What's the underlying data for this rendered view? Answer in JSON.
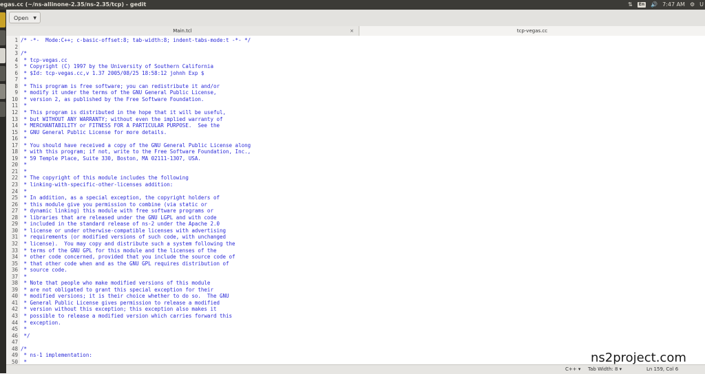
{
  "window": {
    "title": "egas.cc (~/ns-allinone-2.35/ns-2.35/tcp) - gedit"
  },
  "tray": {
    "keyboard": "En",
    "time": "7:47 AM",
    "user": "U"
  },
  "toolbar": {
    "open_label": "Open"
  },
  "tabs": [
    {
      "label": "Main.tcl",
      "close": "×"
    },
    {
      "label": "tcp-vegas.cc"
    }
  ],
  "editor": {
    "lines": [
      {
        "n": "1",
        "text": "/* -*-  Mode:C++; c-basic-offset:8; tab-width:8; indent-tabs-mode:t -*- */"
      },
      {
        "n": "2",
        "text": ""
      },
      {
        "n": "3",
        "text": "/*"
      },
      {
        "n": "4",
        "text": " * tcp-vegas.cc"
      },
      {
        "n": "5",
        "text": " * Copyright (C) 1997 by the University of Southern California"
      },
      {
        "n": "6",
        "text": " * $Id: tcp-vegas.cc,v 1.37 2005/08/25 18:58:12 johnh Exp $"
      },
      {
        "n": "7",
        "text": " *"
      },
      {
        "n": "8",
        "text": " * This program is free software; you can redistribute it and/or"
      },
      {
        "n": "9",
        "text": " * modify it under the terms of the GNU General Public License,"
      },
      {
        "n": "10",
        "text": " * version 2, as published by the Free Software Foundation."
      },
      {
        "n": "11",
        "text": " *"
      },
      {
        "n": "12",
        "text": " * This program is distributed in the hope that it will be useful,"
      },
      {
        "n": "13",
        "text": " * but WITHOUT ANY WARRANTY; without even the implied warranty of"
      },
      {
        "n": "14",
        "text": " * MERCHANTABILITY or FITNESS FOR A PARTICULAR PURPOSE.  See the"
      },
      {
        "n": "15",
        "text": " * GNU General Public License for more details."
      },
      {
        "n": "16",
        "text": " *"
      },
      {
        "n": "17",
        "text": " * You should have received a copy of the GNU General Public License along"
      },
      {
        "n": "18",
        "text": " * with this program; if not, write to the Free Software Foundation, Inc.,"
      },
      {
        "n": "19",
        "text": " * 59 Temple Place, Suite 330, Boston, MA 02111-1307, USA."
      },
      {
        "n": "20",
        "text": " *"
      },
      {
        "n": "21",
        "text": " *"
      },
      {
        "n": "22",
        "text": " * The copyright of this module includes the following"
      },
      {
        "n": "23",
        "text": " * linking-with-specific-other-licenses addition:"
      },
      {
        "n": "24",
        "text": " *"
      },
      {
        "n": "25",
        "text": " * In addition, as a special exception, the copyright holders of"
      },
      {
        "n": "26",
        "text": " * this module give you permission to combine (via static or"
      },
      {
        "n": "27",
        "text": " * dynamic linking) this module with free software programs or"
      },
      {
        "n": "28",
        "text": " * libraries that are released under the GNU LGPL and with code"
      },
      {
        "n": "29",
        "text": " * included in the standard release of ns-2 under the Apache 2.0"
      },
      {
        "n": "30",
        "text": " * license or under otherwise-compatible licenses with advertising"
      },
      {
        "n": "31",
        "text": " * requirements (or modified versions of such code, with unchanged"
      },
      {
        "n": "32",
        "text": " * license).  You may copy and distribute such a system following the"
      },
      {
        "n": "33",
        "text": " * terms of the GNU GPL for this module and the licenses of the"
      },
      {
        "n": "34",
        "text": " * other code concerned, provided that you include the source code of"
      },
      {
        "n": "35",
        "text": " * that other code when and as the GNU GPL requires distribution of"
      },
      {
        "n": "36",
        "text": " * source code."
      },
      {
        "n": "37",
        "text": " *"
      },
      {
        "n": "38",
        "text": " * Note that people who make modified versions of this module"
      },
      {
        "n": "39",
        "text": " * are not obligated to grant this special exception for their"
      },
      {
        "n": "40",
        "text": " * modified versions; it is their choice whether to do so.  The GNU"
      },
      {
        "n": "41",
        "text": " * General Public License gives permission to release a modified"
      },
      {
        "n": "42",
        "text": " * version without this exception; this exception also makes it"
      },
      {
        "n": "43",
        "text": " * possible to release a modified version which carries forward this"
      },
      {
        "n": "44",
        "text": " * exception."
      },
      {
        "n": "45",
        "text": " *"
      },
      {
        "n": "46",
        "text": " */"
      },
      {
        "n": "47",
        "text": ""
      },
      {
        "n": "48",
        "text": "/*"
      },
      {
        "n": "49",
        "text": " * ns-1 implementation:"
      },
      {
        "n": "50",
        "text": " *"
      }
    ]
  },
  "statusbar": {
    "language": "C++",
    "tab_width": "Tab Width: 8",
    "position": "Ln 159, Col 6"
  },
  "watermark": "ns2project.com",
  "colors": {
    "code_text": "#2a2ad8",
    "panel": "#3c3b37"
  }
}
